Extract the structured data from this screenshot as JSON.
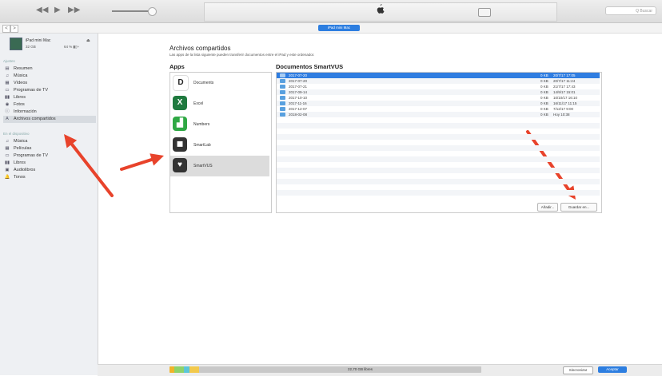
{
  "toolbar": {
    "rewind": "◀◀",
    "play": "▶",
    "forward": "▶▶",
    "search_placeholder": "Q Buscar"
  },
  "subbar": {
    "back": "<",
    "forward": ">",
    "device_button": "iPad mini Mac"
  },
  "device": {
    "name": "iPad mini Mac",
    "capacity": "32 GB",
    "battery": "64 % ▮▯+",
    "eject": "⏏"
  },
  "sidebar": {
    "section_settings": "Ajustes",
    "settings_items": [
      {
        "icon": "summary-icon",
        "glyph": "▤",
        "label": "Resumen"
      },
      {
        "icon": "music-icon",
        "glyph": "♫",
        "label": "Música"
      },
      {
        "icon": "film-icon",
        "glyph": "▦",
        "label": "Vídeos"
      },
      {
        "icon": "tv-icon",
        "glyph": "▭",
        "label": "Programas de TV"
      },
      {
        "icon": "book-icon",
        "glyph": "▮▮",
        "label": "Libros"
      },
      {
        "icon": "photos-icon",
        "glyph": "◉",
        "label": "Fotos"
      },
      {
        "icon": "info-icon",
        "glyph": "ⓘ",
        "label": "Información"
      },
      {
        "icon": "apps-icon",
        "glyph": "A",
        "label": "Archivos compartidos"
      }
    ],
    "section_device": "En el dispositivo",
    "device_items": [
      {
        "icon": "music-icon",
        "glyph": "♫",
        "label": "Música"
      },
      {
        "icon": "film-icon",
        "glyph": "▦",
        "label": "Películas"
      },
      {
        "icon": "tv-icon",
        "glyph": "▭",
        "label": "Programas de TV"
      },
      {
        "icon": "book-icon",
        "glyph": "▮▮",
        "label": "Libros"
      },
      {
        "icon": "audiobook-icon",
        "glyph": "▣",
        "label": "Audiolibros"
      },
      {
        "icon": "tones-icon",
        "glyph": "🔔",
        "label": "Tonos"
      }
    ]
  },
  "main": {
    "title": "Archivos compartidos",
    "description": "Las apps de la lista siguiente pueden transferir documentos entre el iPad y este ordenador.",
    "apps_heading": "Apps",
    "docs_heading": "Documentos SmartVUS",
    "apps": [
      {
        "name": "Documents",
        "glyph": "D",
        "color": "#ffffff",
        "fg": "#222222",
        "selected": false
      },
      {
        "name": "Excel",
        "glyph": "X",
        "color": "#1f7a3f",
        "fg": "#ffffff",
        "selected": false
      },
      {
        "name": "Numbers",
        "glyph": "▟",
        "color": "#2fa844",
        "fg": "#ffffff",
        "selected": false
      },
      {
        "name": "SmartLab",
        "glyph": "◼",
        "color": "#333333",
        "fg": "#ffffff",
        "selected": false
      },
      {
        "name": "SmartVUS",
        "glyph": "♥",
        "color": "#333333",
        "fg": "#ffffff",
        "selected": true
      }
    ],
    "documents": [
      {
        "name": "2017-07-20",
        "size": "0 KB",
        "date": "20/7/17 17:05",
        "selected": true
      },
      {
        "name": "2017-07-20",
        "size": "0 KB",
        "date": "20/7/17 11:24",
        "selected": false
      },
      {
        "name": "2017-07-21",
        "size": "0 KB",
        "date": "21/7/17 17:43",
        "selected": false
      },
      {
        "name": "2017-09-14",
        "size": "0 KB",
        "date": "14/9/17 15:01",
        "selected": false
      },
      {
        "name": "2017-10-10",
        "size": "0 KB",
        "date": "10/10/17 16:10",
        "selected": false
      },
      {
        "name": "2017-11-16",
        "size": "0 KB",
        "date": "16/11/17 11:15",
        "selected": false
      },
      {
        "name": "2017-12-07",
        "size": "0 KB",
        "date": "7/12/17 9:00",
        "selected": false
      },
      {
        "name": "2018-02-08",
        "size": "0 KB",
        "date": "Hoy 10:38",
        "selected": false
      }
    ],
    "add_button": "Añadir...",
    "save_button": "Guardar en..."
  },
  "bottom": {
    "capacity_label": "22,70 GB libres",
    "sync_button": "Sincronizar",
    "done_button": "Aceptar",
    "segments": [
      {
        "color": "#f0b429",
        "fraction": 0.015
      },
      {
        "color": "#8fd26a",
        "fraction": 0.03
      },
      {
        "color": "#5cc6d8",
        "fraction": 0.02
      },
      {
        "color": "#f2c94c",
        "fraction": 0.03
      }
    ]
  },
  "annotations": {
    "arrow_color": "#e8432b"
  }
}
